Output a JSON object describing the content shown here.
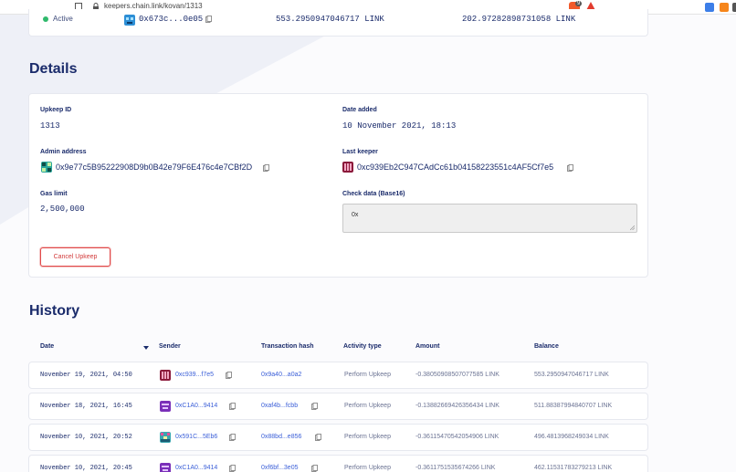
{
  "browser": {
    "url": "keepers.chain.link/kovan/1313",
    "brave_badge": "9"
  },
  "top_row": {
    "status": "Active",
    "address": "0x673c...0e05",
    "amount1": "553.2950947046717 LINK",
    "amount2": "202.97282898731058 LINK"
  },
  "details": {
    "title": "Details",
    "upkeep_id_label": "Upkeep ID",
    "upkeep_id": "1313",
    "date_added_label": "Date added",
    "date_added": "10 November 2021, 18:13",
    "admin_address_label": "Admin address",
    "admin_address": "0x9e77c5B95222908D9b0B42e79F6E476c4e7CBf2D",
    "last_keeper_label": "Last keeper",
    "last_keeper": "0xc939Eb2C947CAdCc61b04158223551c4AF5Cf7e5",
    "gas_limit_label": "Gas limit",
    "gas_limit": "2,500,000",
    "check_data_label": "Check data (Base16)",
    "check_data": "0x",
    "cancel_label": "Cancel Upkeep"
  },
  "history": {
    "title": "History",
    "columns": {
      "date": "Date",
      "sender": "Sender",
      "tx_hash": "Transaction hash",
      "activity": "Activity type",
      "amount": "Amount",
      "balance": "Balance"
    },
    "rows": [
      {
        "date": "November 19, 2021, 04:50",
        "sender": "0xc939...f7e5",
        "tx": "0x9a40...a0a2",
        "activity": "Perform Upkeep",
        "amount": "-0.38050908507077585 LINK",
        "balance": "553.2950947046717 LINK",
        "avatar_color": "#8b1a3b"
      },
      {
        "date": "November 18, 2021, 16:45",
        "sender": "0xC1A0...9414",
        "tx": "0xaf4b...fcbb",
        "activity": "Perform Upkeep",
        "amount": "-0.13882669426356434 LINK",
        "balance": "511.88387994840707 LINK",
        "avatar_color": "#7a2fb8"
      },
      {
        "date": "November 10, 2021, 20:52",
        "sender": "0x591C...5Eb6",
        "tx": "0x88bd...e856",
        "activity": "Perform Upkeep",
        "amount": "-0.36115470542054906 LINK",
        "balance": "496.4813968249034 LINK",
        "avatar_color": "#3aa6b0"
      },
      {
        "date": "November 10, 2021, 20:45",
        "sender": "0xC1A0...9414",
        "tx": "0xf6bf...3e05",
        "activity": "Perform Upkeep",
        "amount": "-0.3611751535674266 LINK",
        "balance": "462.11531783279213 LINK",
        "avatar_color": "#7a2fb8"
      }
    ]
  },
  "colors": {
    "accent": "#1a2b6b",
    "link": "#3b5fd8",
    "danger": "#d23c3c",
    "active": "#2fb96c"
  }
}
